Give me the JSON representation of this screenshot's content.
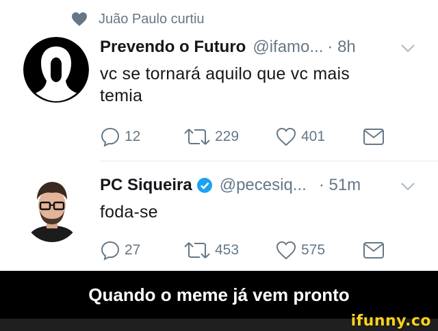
{
  "social_context": {
    "text": "Juão Paulo curtiu",
    "icon": "heart-icon"
  },
  "tweets": [
    {
      "name": "Prevendo o Futuro",
      "handle": "@ifamo...",
      "time": "· 8h",
      "verified": false,
      "text_lines": [
        "vc se tornará aquilo que vc mais",
        "temia"
      ],
      "replies": "12",
      "retweets": "229",
      "likes": "401"
    },
    {
      "name": "PC Siqueira",
      "handle": "@pecesiq...",
      "time": "· 51m",
      "verified": true,
      "text_lines": [
        "foda-se"
      ],
      "replies": "27",
      "retweets": "453",
      "likes": "575"
    }
  ],
  "caption": "Quando o meme já vem pronto",
  "watermark": "ifunny.co",
  "colors": {
    "text": "#14171a",
    "secondary": "#657786",
    "verified": "#1da1f2",
    "caption_bg": "#000000",
    "watermark": "#ffd21e"
  }
}
